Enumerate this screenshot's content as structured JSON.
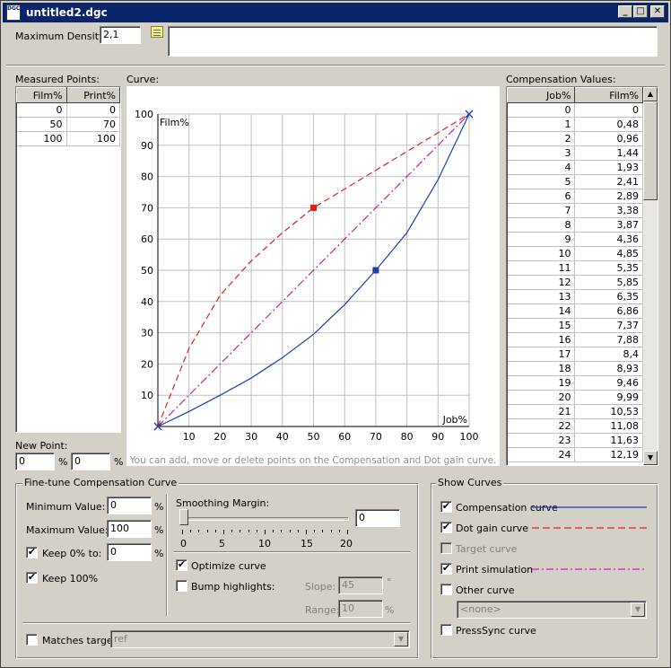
{
  "window": {
    "title": "untitled2.dgc",
    "icon_text": "DGC"
  },
  "header": {
    "max_density_label": "Maximum Density :",
    "max_density_value": "2,1",
    "note_value": ""
  },
  "measured": {
    "label": "Measured Points:",
    "columns": [
      "Film%",
      "Print%"
    ],
    "rows": [
      [
        "0",
        "0"
      ],
      [
        "50",
        "70"
      ],
      [
        "100",
        "100"
      ]
    ]
  },
  "curve": {
    "label": "Curve:",
    "hint": "You can add, move or delete points on the Compensation and Dot gain curve."
  },
  "chart_data": {
    "type": "line",
    "xlabel": "Job%",
    "ylabel": "Film%",
    "xlim": [
      0,
      100
    ],
    "ylim": [
      0,
      100
    ],
    "x_ticks": [
      10,
      20,
      30,
      40,
      50,
      60,
      70,
      80,
      90,
      100
    ],
    "y_ticks": [
      10,
      20,
      30,
      40,
      50,
      60,
      70,
      80,
      90,
      100
    ],
    "grid": true,
    "series": [
      {
        "name": "Compensation curve",
        "color": "#1a3fb0",
        "style": "solid",
        "x": [
          0,
          10,
          20,
          30,
          40,
          50,
          60,
          70,
          80,
          90,
          100
        ],
        "y": [
          0,
          4.8,
          10,
          15.5,
          22,
          29.5,
          39,
          50,
          62,
          79,
          100
        ],
        "markers": [
          [
            70,
            50
          ]
        ]
      },
      {
        "name": "Dot gain curve",
        "color": "#e02020",
        "style": "dashed",
        "x": [
          0,
          10,
          20,
          30,
          40,
          50,
          60,
          70,
          80,
          90,
          100
        ],
        "y": [
          0,
          25,
          42,
          53,
          62,
          70,
          76,
          82,
          88,
          94,
          100
        ],
        "markers": [
          [
            50,
            70
          ]
        ]
      },
      {
        "name": "Print simulation",
        "color": "#c020c0",
        "style": "dashdot",
        "x": [
          0,
          100
        ],
        "y": [
          0,
          100
        ],
        "markers": []
      }
    ]
  },
  "compensation": {
    "label": "Compensation Values:",
    "columns": [
      "Job%",
      "Film%"
    ],
    "rows": [
      [
        "0",
        "0"
      ],
      [
        "1",
        "0,48"
      ],
      [
        "2",
        "0,96"
      ],
      [
        "3",
        "1,44"
      ],
      [
        "4",
        "1,93"
      ],
      [
        "5",
        "2,41"
      ],
      [
        "6",
        "2,89"
      ],
      [
        "7",
        "3,38"
      ],
      [
        "8",
        "3,87"
      ],
      [
        "9",
        "4,36"
      ],
      [
        "10",
        "4,85"
      ],
      [
        "11",
        "5,35"
      ],
      [
        "12",
        "5,85"
      ],
      [
        "13",
        "6,35"
      ],
      [
        "14",
        "6,86"
      ],
      [
        "15",
        "7,37"
      ],
      [
        "16",
        "7,88"
      ],
      [
        "17",
        "8,4"
      ],
      [
        "18",
        "8,93"
      ],
      [
        "19",
        "9,46"
      ],
      [
        "20",
        "9,99"
      ],
      [
        "21",
        "10,53"
      ],
      [
        "22",
        "11,08"
      ],
      [
        "23",
        "11,63"
      ],
      [
        "24",
        "12,19"
      ]
    ]
  },
  "new_point": {
    "label": "New Point:",
    "x_value": "0",
    "y_value": "0",
    "unit": "%"
  },
  "finetune": {
    "title": "Fine-tune Compensation Curve",
    "min_label": "Minimum Value:",
    "min_value": "0",
    "max_label": "Maximum Value:",
    "max_value": "100",
    "keep0_label": "Keep 0% to:",
    "keep0_value": "0",
    "keep0_checked": true,
    "keep100_label": "Keep 100%",
    "keep100_checked": true,
    "unit": "%",
    "smoothing_label": "Smoothing Margin:",
    "smoothing_value": "0",
    "slider_ticks": [
      "0",
      "5",
      "10",
      "15",
      "20"
    ],
    "slider_level": 0,
    "optimize_label": "Optimize curve",
    "optimize_checked": true,
    "bump_label": "Bump highlights:",
    "bump_checked": false,
    "slope_label": "Slope:",
    "slope_value": "45",
    "slope_unit": "°",
    "range_label": "Range:",
    "range_value": "10",
    "range_unit": "%",
    "matches_label": "Matches target:",
    "matches_checked": false,
    "matches_value": "ref"
  },
  "show_curves": {
    "title": "Show Curves",
    "items": [
      {
        "label": "Compensation curve",
        "checked": true,
        "enabled": true
      },
      {
        "label": "Dot gain curve",
        "checked": true,
        "enabled": true
      },
      {
        "label": "Target curve",
        "checked": false,
        "enabled": false
      },
      {
        "label": "Print simulation",
        "checked": true,
        "enabled": true
      },
      {
        "label": "Other curve",
        "checked": false,
        "enabled": true
      }
    ],
    "other_select_value": "<none>",
    "presssync_label": "PressSync curve",
    "presssync_checked": false
  },
  "icons": {
    "note": "note-icon",
    "check": "✔",
    "arrow_down": "▼",
    "arrow_up": "▲"
  }
}
